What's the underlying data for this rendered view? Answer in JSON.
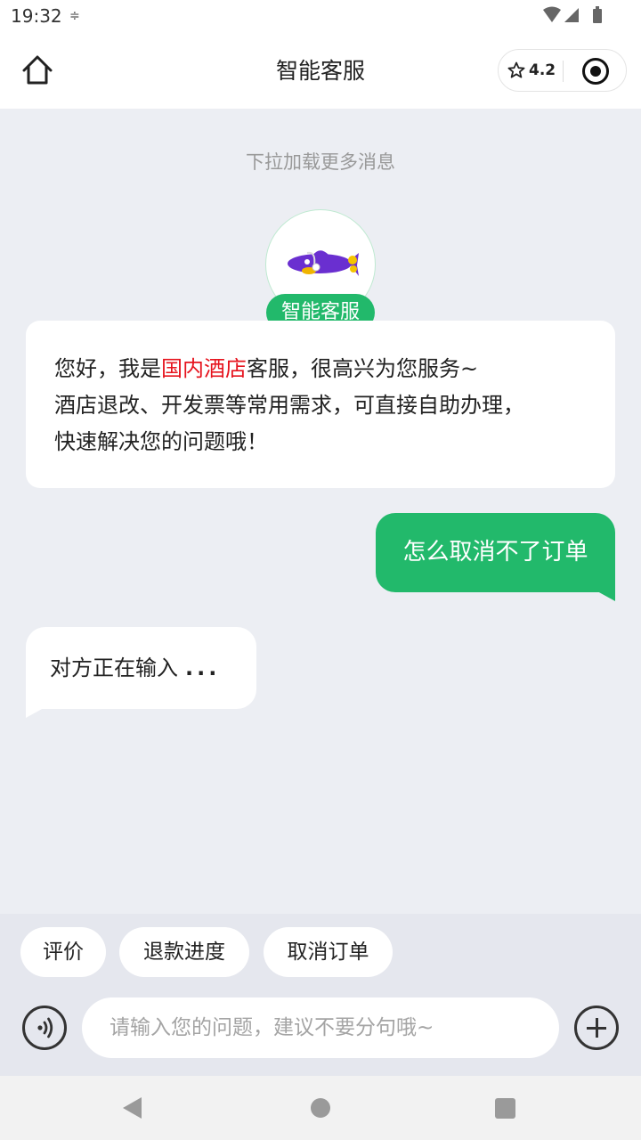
{
  "status_bar": {
    "time": "19:32",
    "indicator": "≑"
  },
  "header": {
    "title": "智能客服",
    "rating": "4.2",
    "icons": {
      "home": "home-icon",
      "star": "star-icon",
      "record": "record-icon"
    }
  },
  "chat": {
    "pull_hint": "下拉加载更多消息",
    "bot_name": "智能客服",
    "welcome": {
      "greeting_prefix": "您好，我是",
      "highlight": "国内酒店",
      "greeting_suffix": "客服，很高兴为您服务~",
      "line2": "酒店退改、开发票等常用需求，可直接自助办理，",
      "line3": "快速解决您的问题哦！"
    },
    "user_message": "怎么取消不了订单",
    "typing_text": "对方正在输入",
    "typing_dots": "..."
  },
  "quick_replies": [
    "评价",
    "退款进度",
    "取消订单"
  ],
  "input": {
    "placeholder": "请输入您的问题，建议不要分句哦~",
    "value": ""
  },
  "colors": {
    "accent": "#22b96b",
    "highlight": "#e6141e",
    "background": "#eceef3"
  }
}
